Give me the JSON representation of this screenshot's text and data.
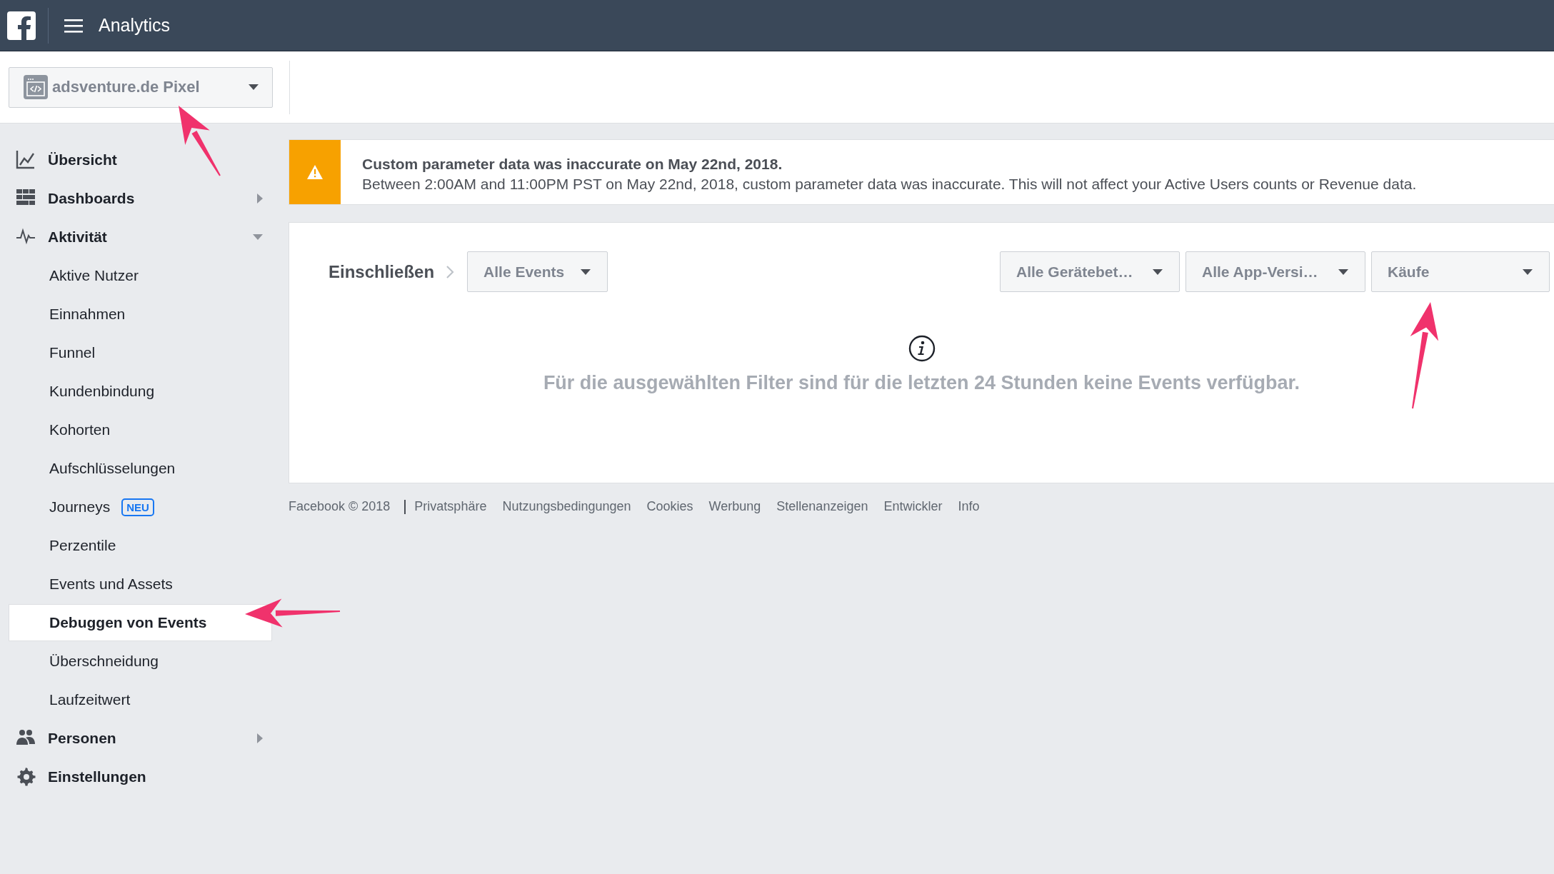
{
  "header": {
    "title": "Analytics"
  },
  "pixel_selector": {
    "label": "adsventure.de Pixel"
  },
  "sidebar": {
    "items": [
      {
        "label": "Übersicht",
        "selected": false
      },
      {
        "label": "Dashboards",
        "selected": false,
        "expanded": false
      },
      {
        "label": "Aktivität",
        "selected": false,
        "expanded": true,
        "children": [
          {
            "label": "Aktive Nutzer",
            "selected": false
          },
          {
            "label": "Einnahmen",
            "selected": false
          },
          {
            "label": "Funnel",
            "selected": false
          },
          {
            "label": "Kundenbindung",
            "selected": false
          },
          {
            "label": "Kohorten",
            "selected": false
          },
          {
            "label": "Aufschlüsselungen",
            "selected": false
          },
          {
            "label": "Journeys",
            "selected": false,
            "badge": "NEU"
          },
          {
            "label": "Perzentile",
            "selected": false
          },
          {
            "label": "Events und Assets",
            "selected": false
          },
          {
            "label": "Debuggen von Events",
            "selected": true
          },
          {
            "label": "Überschneidung",
            "selected": false
          },
          {
            "label": "Laufzeitwert",
            "selected": false
          }
        ]
      },
      {
        "label": "Personen",
        "selected": false,
        "expanded": false
      },
      {
        "label": "Einstellungen",
        "selected": false
      }
    ]
  },
  "alert": {
    "title": "Custom parameter data was inaccurate on May 22nd, 2018.",
    "text": "Between 2:00AM and 11:00PM PST on May 22nd, 2018, custom parameter data was inaccurate. This will not affect your Active Users counts or Revenue data."
  },
  "filters": {
    "label": "Einschließen",
    "event_dropdown": "Alle Events",
    "dropdowns": [
      "Alle Gerätebet…",
      "Alle App-Versi…",
      "Käufe"
    ]
  },
  "empty_message": "Für die ausgewählten Filter sind für die letzten 24 Stunden keine Events verfügbar.",
  "footer": {
    "copyright": "Facebook © 2018",
    "links": [
      "Privatsphäre",
      "Nutzungsbedingungen",
      "Cookies",
      "Werbung",
      "Stellenanzeigen",
      "Entwickler",
      "Info"
    ]
  }
}
